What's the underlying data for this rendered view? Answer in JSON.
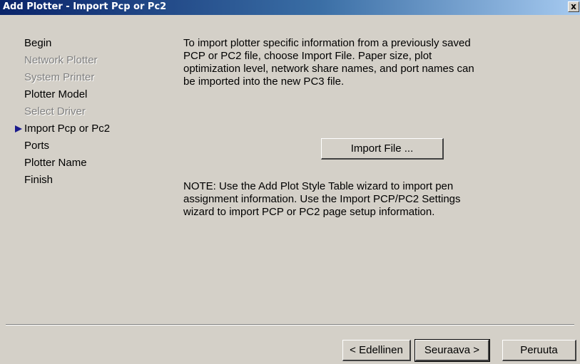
{
  "window": {
    "title": "Add Plotter - Import Pcp or Pc2",
    "close_label": "x"
  },
  "steps": [
    {
      "label": "Begin",
      "state": "enabled"
    },
    {
      "label": "Network Plotter",
      "state": "disabled"
    },
    {
      "label": "System Printer",
      "state": "disabled"
    },
    {
      "label": "Plotter Model",
      "state": "enabled"
    },
    {
      "label": "Select Driver",
      "state": "disabled"
    },
    {
      "label": "Import Pcp or Pc2",
      "state": "current"
    },
    {
      "label": "Ports",
      "state": "enabled"
    },
    {
      "label": "Plotter Name",
      "state": "enabled"
    },
    {
      "label": "Finish",
      "state": "enabled"
    }
  ],
  "content": {
    "description_lines": [
      "To import plotter specific information from a previously saved",
      "PCP or PC2 file, choose Import File. Paper size, plot",
      "optimization level, network share names, and port names can",
      "be imported into the new PC3 file."
    ],
    "import_button_label": "Import File ...",
    "note_lines": [
      "NOTE: Use the Add Plot Style Table wizard to import pen",
      "assignment information. Use the Import PCP/PC2 Settings",
      "wizard to import PCP or PC2 page setup information."
    ]
  },
  "buttons": {
    "back_label": "< Edellinen",
    "next_label": "Seuraava >",
    "cancel_label": "Peruuta"
  },
  "icons": {
    "current_step_marker": "current-step-arrow-icon",
    "close": "close-icon"
  },
  "colors": {
    "title_bar_start": "#0a246a",
    "title_bar_end": "#a6caf0",
    "dialog_background": "#d4d0c8",
    "disabled_text": "#808080",
    "current_step_arrow": "#1a1a8c"
  }
}
